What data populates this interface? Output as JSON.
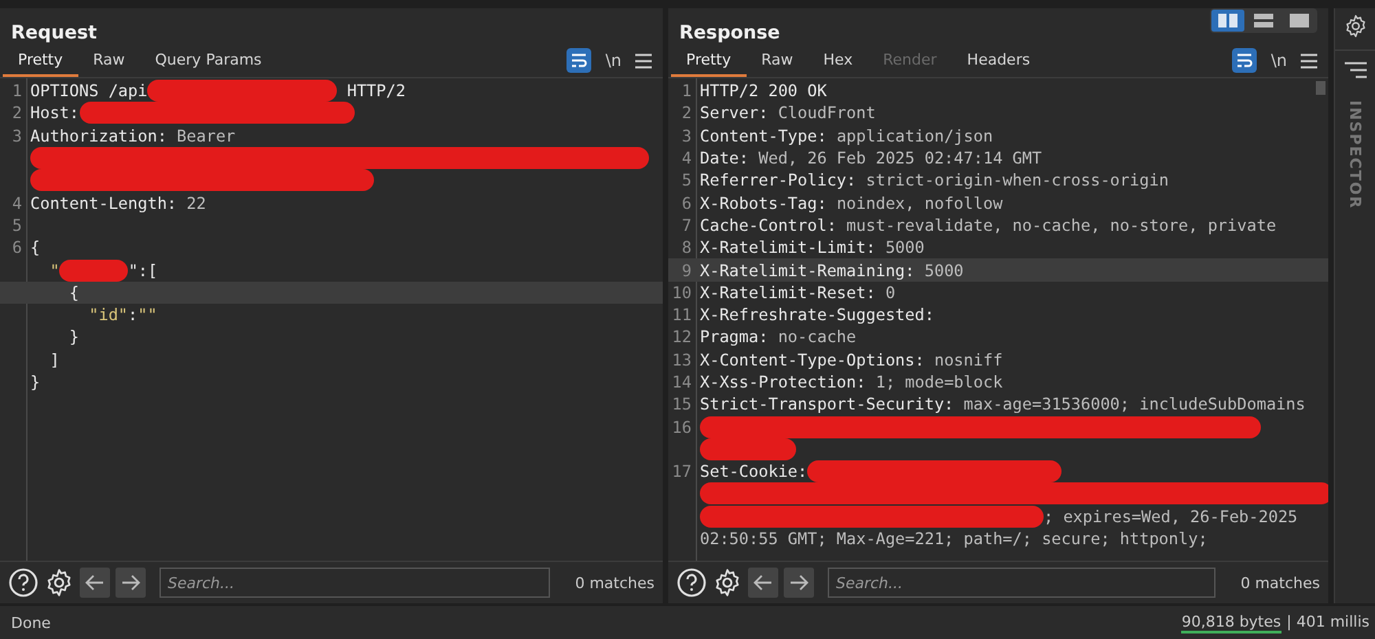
{
  "view_buttons": [
    {
      "kind": "columns",
      "selected": true
    },
    {
      "kind": "rows",
      "selected": false
    },
    {
      "kind": "single",
      "selected": false
    }
  ],
  "panes": [
    {
      "title": "Request",
      "tabs": [
        {
          "label": "Pretty",
          "selected": true,
          "disabled": false
        },
        {
          "label": "Raw",
          "selected": false,
          "disabled": false
        },
        {
          "label": "Query Params",
          "selected": false,
          "disabled": false
        }
      ],
      "newline_toggle": "\\n",
      "lines": [
        {
          "number": "1",
          "highlighted": false,
          "segments": [
            {
              "kind": "name",
              "text": "OPTIONS /api"
            },
            {
              "kind": "redaction"
            },
            {
              "kind": "name",
              "text": " HTTP/2"
            }
          ]
        },
        {
          "number": "2",
          "highlighted": false,
          "segments": [
            {
              "kind": "name",
              "text": "Host:"
            },
            {
              "kind": "redaction"
            }
          ]
        },
        {
          "number": "3",
          "highlighted": false,
          "segments": [
            {
              "kind": "name",
              "text": "Authorization:"
            },
            {
              "kind": "value",
              "text": " Bearer"
            }
          ]
        },
        {
          "highlighted": false,
          "segments": [
            {
              "kind": "redaction"
            }
          ]
        },
        {
          "highlighted": false,
          "segments": [
            {
              "kind": "redaction"
            }
          ]
        },
        {
          "number": "4",
          "highlighted": false,
          "segments": [
            {
              "kind": "name",
              "text": "Content-Length:"
            },
            {
              "kind": "value",
              "text": " 22"
            }
          ]
        },
        {
          "number": "5",
          "highlighted": false
        },
        {
          "number": "6",
          "highlighted": false,
          "segments": [
            {
              "kind": "name",
              "text": "{"
            }
          ]
        },
        {
          "highlighted": false,
          "segments": [
            {
              "kind": "string",
              "text": "  \""
            },
            {
              "kind": "redaction"
            },
            {
              "kind": "name",
              "text": "\":["
            }
          ]
        },
        {
          "highlighted": true,
          "segments": [
            {
              "kind": "name",
              "text": "    {"
            }
          ]
        },
        {
          "highlighted": false,
          "segments": [
            {
              "kind": "string",
              "text": "      \"id\""
            },
            {
              "kind": "name",
              "text": ":"
            },
            {
              "kind": "string",
              "text": "\"\""
            }
          ]
        },
        {
          "highlighted": false,
          "segments": [
            {
              "kind": "name",
              "text": "    }"
            }
          ]
        },
        {
          "highlighted": false,
          "segments": [
            {
              "kind": "name",
              "text": "  ]"
            }
          ]
        },
        {
          "highlighted": false,
          "segments": [
            {
              "kind": "name",
              "text": "}"
            }
          ]
        }
      ],
      "search": {
        "placeholder": "Search..."
      },
      "matches": "0 matches"
    },
    {
      "title": "Response",
      "tabs": [
        {
          "label": "Pretty",
          "selected": true,
          "disabled": false
        },
        {
          "label": "Raw",
          "selected": false,
          "disabled": false
        },
        {
          "label": "Hex",
          "selected": false,
          "disabled": false
        },
        {
          "label": "Render",
          "selected": false,
          "disabled": true
        },
        {
          "label": "Headers",
          "selected": false,
          "disabled": false
        }
      ],
      "newline_toggle": "\\n",
      "lines": [
        {
          "number": "1",
          "highlighted": false,
          "segments": [
            {
              "kind": "name",
              "text": "HTTP/2 200 OK"
            }
          ]
        },
        {
          "number": "2",
          "highlighted": false,
          "segments": [
            {
              "kind": "name",
              "text": "Server:"
            },
            {
              "kind": "value",
              "text": " CloudFront"
            }
          ]
        },
        {
          "number": "3",
          "highlighted": false,
          "segments": [
            {
              "kind": "name",
              "text": "Content-Type:"
            },
            {
              "kind": "value",
              "text": " application/json"
            }
          ]
        },
        {
          "number": "4",
          "highlighted": false,
          "segments": [
            {
              "kind": "name",
              "text": "Date:"
            },
            {
              "kind": "value",
              "text": " Wed, 26 Feb 2025 02:47:14 GMT"
            }
          ]
        },
        {
          "number": "5",
          "highlighted": false,
          "segments": [
            {
              "kind": "name",
              "text": "Referrer-Policy:"
            },
            {
              "kind": "value",
              "text": " strict-origin-when-cross-origin"
            }
          ]
        },
        {
          "number": "6",
          "highlighted": false,
          "segments": [
            {
              "kind": "name",
              "text": "X-Robots-Tag:"
            },
            {
              "kind": "value",
              "text": " noindex, nofollow"
            }
          ]
        },
        {
          "number": "7",
          "highlighted": false,
          "segments": [
            {
              "kind": "name",
              "text": "Cache-Control:"
            },
            {
              "kind": "value",
              "text": " must-revalidate, no-cache, no-store, private"
            }
          ]
        },
        {
          "number": "8",
          "highlighted": false,
          "segments": [
            {
              "kind": "name",
              "text": "X-Ratelimit-Limit:"
            },
            {
              "kind": "value",
              "text": " 5000"
            }
          ]
        },
        {
          "number": "9",
          "highlighted": true,
          "segments": [
            {
              "kind": "name",
              "text": "X-Ratelimit-Remaining:"
            },
            {
              "kind": "value",
              "text": " 5000"
            }
          ]
        },
        {
          "number": "10",
          "highlighted": false,
          "segments": [
            {
              "kind": "name",
              "text": "X-Ratelimit-Reset:"
            },
            {
              "kind": "value",
              "text": " 0"
            }
          ]
        },
        {
          "number": "11",
          "highlighted": false,
          "segments": [
            {
              "kind": "name",
              "text": "X-Refreshrate-Suggested:"
            }
          ]
        },
        {
          "number": "12",
          "highlighted": false,
          "segments": [
            {
              "kind": "name",
              "text": "Pragma:"
            },
            {
              "kind": "value",
              "text": " no-cache"
            }
          ]
        },
        {
          "number": "13",
          "highlighted": false,
          "segments": [
            {
              "kind": "name",
              "text": "X-Content-Type-Options:"
            },
            {
              "kind": "value",
              "text": " nosniff"
            }
          ]
        },
        {
          "number": "14",
          "highlighted": false,
          "segments": [
            {
              "kind": "name",
              "text": "X-Xss-Protection:"
            },
            {
              "kind": "value",
              "text": " 1; mode=block"
            }
          ]
        },
        {
          "number": "15",
          "highlighted": false,
          "segments": [
            {
              "kind": "name",
              "text": "Strict-Transport-Security:"
            },
            {
              "kind": "value",
              "text": " max-age=31536000; includeSubDomains"
            }
          ]
        },
        {
          "number": "16",
          "highlighted": false,
          "segments": [
            {
              "kind": "redaction"
            }
          ]
        },
        {
          "highlighted": false,
          "segments": [
            {
              "kind": "redaction"
            }
          ]
        },
        {
          "number": "17",
          "highlighted": false,
          "segments": [
            {
              "kind": "name",
              "text": "Set-Cookie:"
            },
            {
              "kind": "redaction"
            }
          ]
        },
        {
          "highlighted": false,
          "segments": [
            {
              "kind": "redaction"
            }
          ]
        },
        {
          "highlighted": false,
          "segments": [
            {
              "kind": "redaction"
            },
            {
              "kind": "value",
              "text": "; expires=Wed, 26-Feb-2025"
            }
          ]
        },
        {
          "highlighted": false,
          "segments": [
            {
              "kind": "value",
              "text": "02:50:55 GMT; Max-Age=221; path=/; secure; httponly;"
            }
          ]
        }
      ],
      "search": {
        "placeholder": "Search..."
      },
      "matches": "0 matches"
    }
  ],
  "inspector": {
    "label": "INSPECTOR"
  },
  "status_bar": {
    "state": "Done",
    "bytes": "90,818 bytes",
    "time": "| 401 millis"
  }
}
